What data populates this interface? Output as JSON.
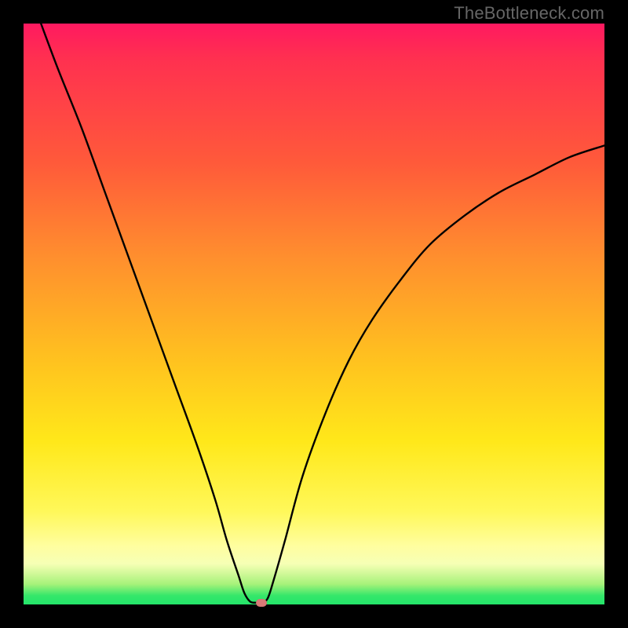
{
  "watermark": "TheBottleneck.com",
  "colors": {
    "frame_bg": "#000000",
    "curve_stroke": "#000000",
    "marker_fill": "#d97a77",
    "gradient_stops": [
      {
        "pos": 0,
        "hex": "#ff1960"
      },
      {
        "pos": 0.06,
        "hex": "#ff3050"
      },
      {
        "pos": 0.24,
        "hex": "#ff5a3a"
      },
      {
        "pos": 0.4,
        "hex": "#ff8e2e"
      },
      {
        "pos": 0.58,
        "hex": "#ffc21f"
      },
      {
        "pos": 0.72,
        "hex": "#ffe81a"
      },
      {
        "pos": 0.84,
        "hex": "#fff85a"
      },
      {
        "pos": 0.9,
        "hex": "#fffea0"
      },
      {
        "pos": 0.93,
        "hex": "#f6ffb5"
      },
      {
        "pos": 0.965,
        "hex": "#a7f27a"
      },
      {
        "pos": 0.985,
        "hex": "#34e76a"
      },
      {
        "pos": 1.0,
        "hex": "#24e56a"
      }
    ]
  },
  "chart_data": {
    "type": "line",
    "title": "",
    "xlabel": "",
    "ylabel": "",
    "xlim": [
      0,
      100
    ],
    "ylim": [
      0,
      100
    ],
    "grid": false,
    "legend": false,
    "curve_points": [
      {
        "x": 3,
        "y": 100
      },
      {
        "x": 6,
        "y": 92
      },
      {
        "x": 10,
        "y": 82
      },
      {
        "x": 14,
        "y": 71
      },
      {
        "x": 18,
        "y": 60
      },
      {
        "x": 22,
        "y": 49
      },
      {
        "x": 26,
        "y": 38
      },
      {
        "x": 30,
        "y": 27
      },
      {
        "x": 33,
        "y": 18
      },
      {
        "x": 35,
        "y": 11
      },
      {
        "x": 37,
        "y": 5
      },
      {
        "x": 38,
        "y": 2
      },
      {
        "x": 39,
        "y": 0.5
      },
      {
        "x": 40,
        "y": 0.3
      },
      {
        "x": 41,
        "y": 0.3
      },
      {
        "x": 42,
        "y": 1
      },
      {
        "x": 43,
        "y": 4
      },
      {
        "x": 45,
        "y": 11
      },
      {
        "x": 48,
        "y": 22
      },
      {
        "x": 52,
        "y": 33
      },
      {
        "x": 56,
        "y": 42
      },
      {
        "x": 60,
        "y": 49
      },
      {
        "x": 65,
        "y": 56
      },
      {
        "x": 70,
        "y": 62
      },
      {
        "x": 76,
        "y": 67
      },
      {
        "x": 82,
        "y": 71
      },
      {
        "x": 88,
        "y": 74
      },
      {
        "x": 94,
        "y": 77
      },
      {
        "x": 100,
        "y": 79
      }
    ],
    "marker": {
      "x": 41,
      "y": 0.3
    },
    "notes": "V-shaped bottleneck curve over heatmap gradient; minimum near x≈40–41. Values read approximately from un-labeled axes using the 740×740 plot area as 0–100 on each axis."
  }
}
